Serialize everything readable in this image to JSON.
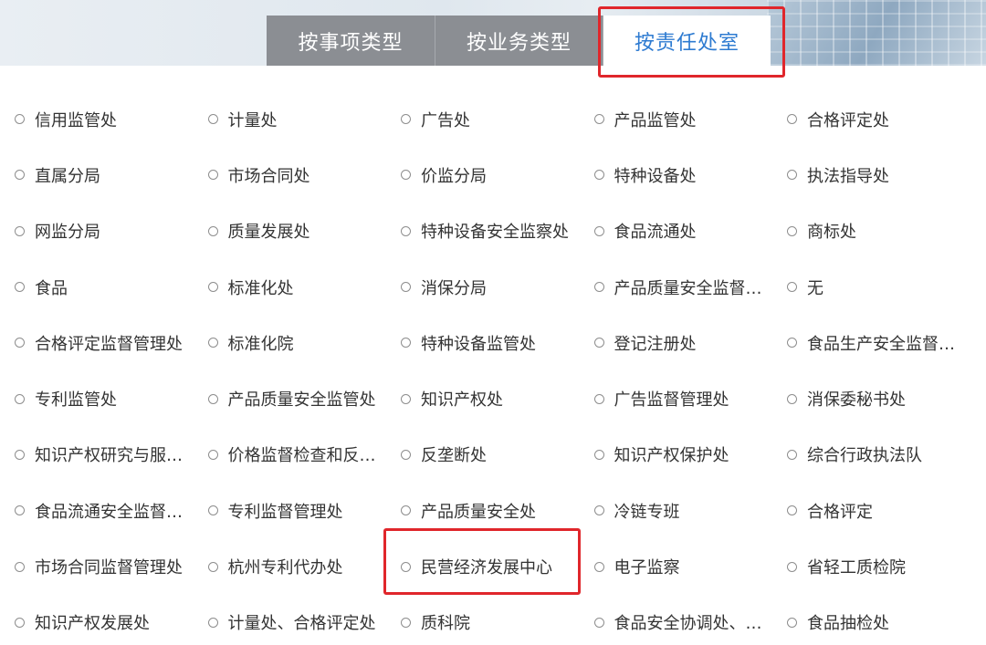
{
  "tabs": [
    {
      "label": "按事项类型",
      "active": false
    },
    {
      "label": "按业务类型",
      "active": false
    },
    {
      "label": "按责任处室",
      "active": true
    }
  ],
  "departments": [
    [
      "信用监管处",
      "计量处",
      "广告处",
      "产品监管处",
      "合格评定处"
    ],
    [
      "直属分局",
      "市场合同处",
      "价监分局",
      "特种设备处",
      "执法指导处"
    ],
    [
      "网监分局",
      "质量发展处",
      "特种设备安全监察处",
      "食品流通处",
      "商标处"
    ],
    [
      "食品",
      "标准化处",
      "消保分局",
      "产品质量安全监督管…",
      "无"
    ],
    [
      "合格评定监督管理处",
      "标准化院",
      "特种设备监管处",
      "登记注册处",
      "食品生产安全监督管…"
    ],
    [
      "专利监管处",
      "产品质量安全监管处",
      "知识产权处",
      "广告监督管理处",
      "消保委秘书处"
    ],
    [
      "知识产权研究与服务…",
      "价格监督检查和反不…",
      "反垄断处",
      "知识产权保护处",
      "综合行政执法队"
    ],
    [
      "食品流通安全监督管…",
      "专利监督管理处",
      "产品质量安全处",
      "冷链专班",
      "合格评定"
    ],
    [
      "市场合同监督管理处",
      "杭州专利代办处",
      "民营经济发展中心",
      "电子监察",
      "省轻工质检院"
    ],
    [
      "知识产权发展处",
      "计量处、合格评定处",
      "质科院",
      "食品安全协调处、食…",
      "食品抽检处"
    ]
  ],
  "colors": {
    "active_tab_text": "#2e7bd1",
    "inactive_tab_bg": "#8b8e93",
    "highlight_box": "#e0262b"
  }
}
